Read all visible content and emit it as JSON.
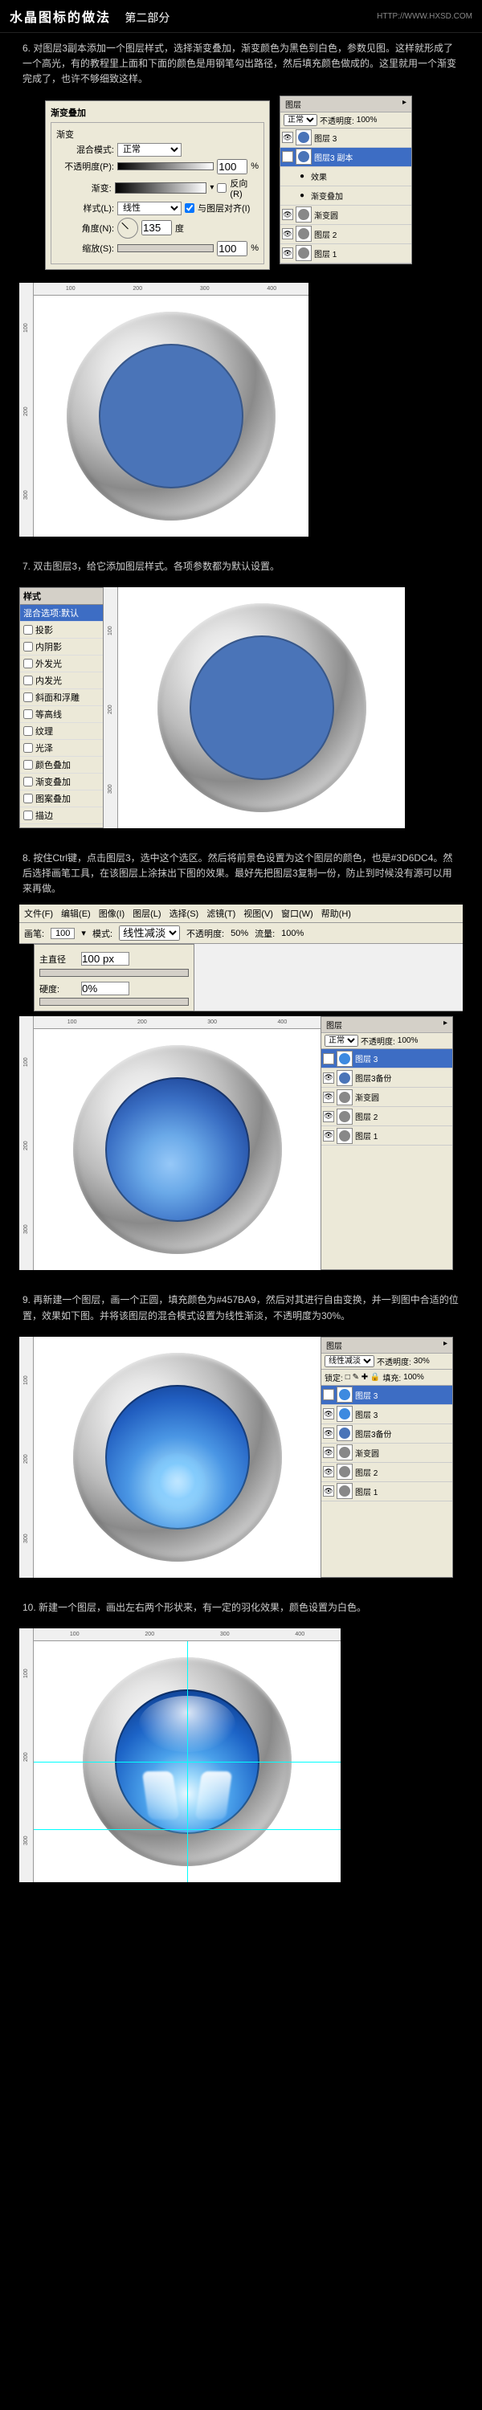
{
  "header": {
    "title": "水晶图标的做法",
    "part": "第二部分",
    "url": "HTTP://WWW.HXSD.COM"
  },
  "step6": {
    "text": "6. 对图层3副本添加一个图层样式，选择渐变叠加，渐变颜色为黑色到白色，参数见图。这样就形成了一个高光，有的教程里上面和下面的颜色是用钢笔勾出路径，然后填充颜色做成的。这里就用一个渐变完成了，也许不够细致这样。",
    "dlg_title": "渐变叠加",
    "sub": "渐变",
    "blend_lbl": "混合模式:",
    "blend": "正常",
    "opacity_lbl": "不透明度(P):",
    "opacity": "100",
    "pct": "%",
    "grad_lbl": "渐变:",
    "reverse": "反向(R)",
    "style_lbl": "样式(L):",
    "style": "线性",
    "align": "与图层对齐(I)",
    "angle_lbl": "角度(N):",
    "angle": "135",
    "deg": "度",
    "scale_lbl": "缩放(S):",
    "scale": "100"
  },
  "layers6": {
    "tab": "图层",
    "opacity": "不透明度:",
    "opval": "100%",
    "mode": "正常",
    "items": [
      {
        "name": "图层 3",
        "c": "#4a74b8"
      },
      {
        "name": "图层3 副本",
        "sel": true,
        "c": "#4a74b8"
      },
      {
        "name": "效果",
        "fx": true
      },
      {
        "name": "渐变叠加",
        "fx": true
      },
      {
        "name": "渐变圆",
        "c": "#888"
      },
      {
        "name": "图层 2",
        "c": "#888"
      },
      {
        "name": "图层 1",
        "c": "#888"
      }
    ]
  },
  "step7": {
    "text": "7. 双击图层3，给它添加图层样式。各项参数都为默认设置。"
  },
  "stylelist": {
    "title": "样式",
    "items": [
      "混合选项:默认",
      "投影",
      "内阴影",
      "外发光",
      "内发光",
      "斜面和浮雕",
      "等高线",
      "纹理",
      "光泽",
      "颜色叠加",
      "渐变叠加",
      "图案叠加",
      "描边"
    ],
    "sel": "混合选项:默认"
  },
  "step8": {
    "text": "8. 按住Ctrl键，点击图层3，选中这个选区。然后将前景色设置为这个图层的颜色，也是#3D6DC4。然后选择画笔工具，在该图层上涂抹出下图的效果。最好先把图层3复制一份，防止到时候没有源可以用来再做。"
  },
  "menubar": [
    "文件(F)",
    "编辑(E)",
    "图像(I)",
    "图层(L)",
    "选择(S)",
    "滤镜(T)",
    "视图(V)",
    "窗口(W)",
    "帮助(H)"
  ],
  "brushbar": {
    "brush_lbl": "画笔:",
    "size": "100",
    "mode_lbl": "模式:",
    "mode": "线性减淡",
    "op_lbl": "不透明度:",
    "op": "50%",
    "flow_lbl": "流量:",
    "flow": "100%"
  },
  "brushpop": {
    "d_lbl": "主直径",
    "d": "100 px",
    "h_lbl": "硬度:",
    "h": "0%"
  },
  "layers8": {
    "items": [
      {
        "name": "图层 3",
        "sel": true,
        "c": "#3d8ae0"
      },
      {
        "name": "图层3备份",
        "c": "#4a74b8"
      },
      {
        "name": "渐变圆",
        "c": "#888"
      },
      {
        "name": "图层 2",
        "c": "#888"
      },
      {
        "name": "图层 1",
        "c": "#888"
      }
    ]
  },
  "step9": {
    "text": "9. 再新建一个图层，画一个正圆，填充颜色为#457BA9，然后对其进行自由变换，并一到图中合适的位置，效果如下图。并将该图层的混合模式设置为线性渐淡，不透明度为30%。"
  },
  "layers9": {
    "tab": "图层",
    "mode": "线性减淡",
    "op": "不透明度:",
    "opval": "30%",
    "lock": "锁定:",
    "fill": "填充:",
    "fillval": "100%",
    "items": [
      {
        "name": "图层 3",
        "sel": true,
        "c": "#3d8ae0"
      },
      {
        "name": "图层 3",
        "c": "#3d8ae0"
      },
      {
        "name": "图层3备份",
        "c": "#4a74b8"
      },
      {
        "name": "渐变圆",
        "c": "#888"
      },
      {
        "name": "图层 2",
        "c": "#888"
      },
      {
        "name": "图层 1",
        "c": "#888"
      }
    ]
  },
  "step10": {
    "text": "10. 新建一个图层，画出左右两个形状来，有一定的羽化效果，颜色设置为白色。"
  },
  "rulemarks": [
    "100",
    "200",
    "300",
    "400"
  ]
}
